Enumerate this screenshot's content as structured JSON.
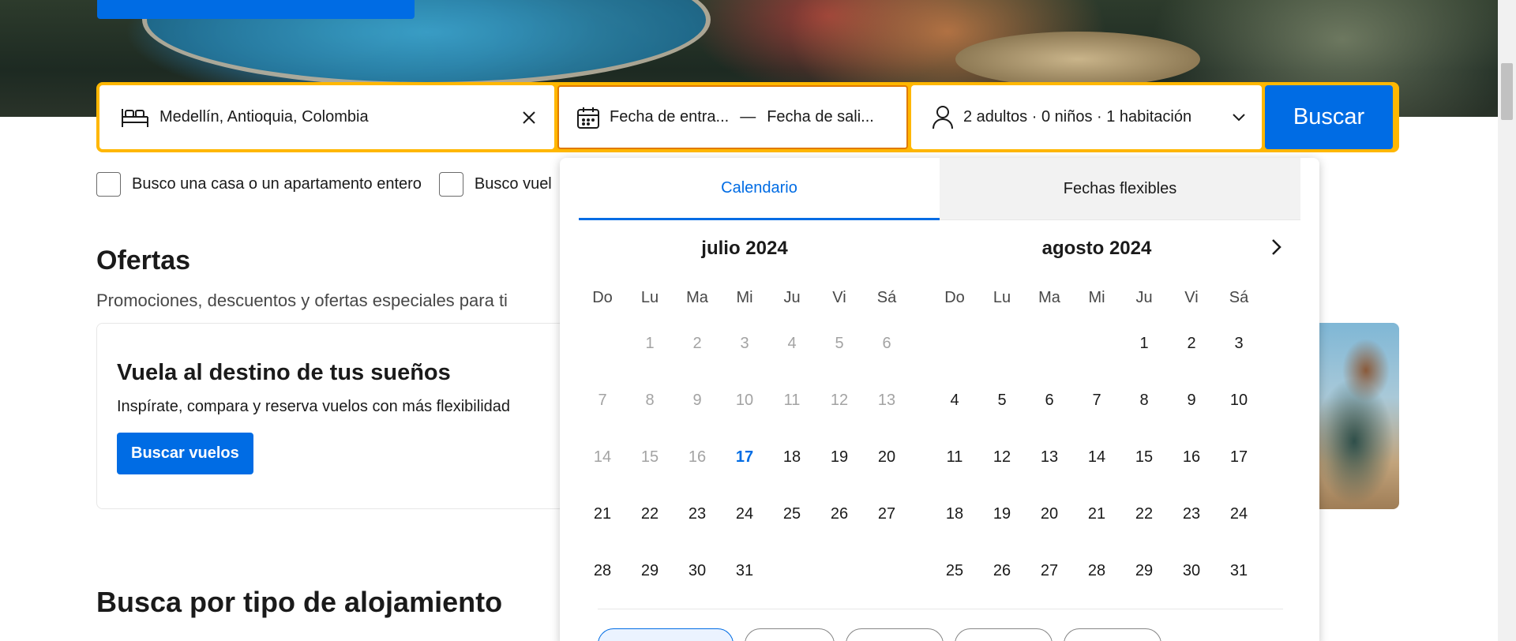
{
  "search": {
    "destination": "Medellín, Antioquia, Colombia",
    "checkin_placeholder": "Fecha de entra...",
    "date_separator": "—",
    "checkout_placeholder": "Fecha de sali...",
    "guests": "2 adultos · 0 niños · 1 habitación",
    "search_label": "Buscar"
  },
  "filters": {
    "whole_home": "Busco una casa o un apartamento entero",
    "flights": "Busco vuel"
  },
  "offers": {
    "title": "Ofertas",
    "subtitle": "Promociones, descuentos y ofertas especiales para ti",
    "card_title": "Vuela al destino de tus sueños",
    "card_text": "Inspírate, compara y reserva vuelos con más flexibilidad",
    "card_button": "Buscar vuelos"
  },
  "types": {
    "title": "Busca por tipo de alojamiento"
  },
  "calendar": {
    "tab_calendar": "Calendario",
    "tab_flexible": "Fechas flexibles",
    "weekdays": [
      "Do",
      "Lu",
      "Ma",
      "Mi",
      "Ju",
      "Vi",
      "Sá"
    ],
    "months": [
      {
        "title": "julio 2024",
        "offset": 1,
        "days": 31,
        "today": 17
      },
      {
        "title": "agosto 2024",
        "offset": 4,
        "days": 31,
        "today": null
      }
    ]
  },
  "colors": {
    "accent": "#006ce4",
    "highlight": "#ffb700",
    "past_day": "#a3a3a3"
  },
  "icons": {
    "destination": "bed-icon",
    "clear": "close-icon",
    "dates": "calendar-icon",
    "guests": "person-icon",
    "guests_toggle": "chevron-down-icon",
    "next_month": "chevron-right-icon"
  }
}
